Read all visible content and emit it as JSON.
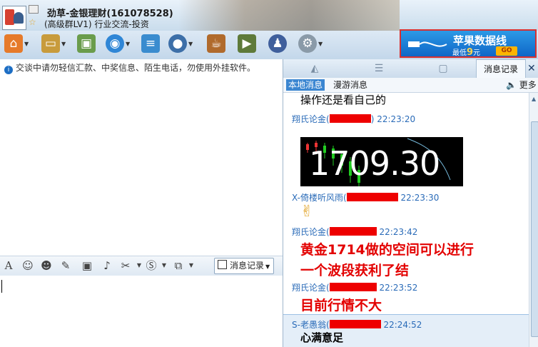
{
  "window": {
    "title": "劲草-金银理财(161078528)",
    "subtitle": "(高级群LV1) 行业交流-投资"
  },
  "ad": {
    "headline": "苹果数据线",
    "price_prefix": "最低",
    "price": "9",
    "price_unit": "元",
    "cta": "GO"
  },
  "notice": {
    "text": "交谈中请勿轻信汇款、中奖信息、陌生电话，勿使用外挂软件。"
  },
  "edit_toolbar": {
    "history_label": "消息记录"
  },
  "right_panel": {
    "tab_history": "消息记录",
    "sub_local": "本地消息",
    "sub_roam": "漫游消息",
    "more": "更多"
  },
  "messages": [
    {
      "text": "操作还是看自己的"
    },
    {
      "sender": "翔氏论金(",
      "suffix": ")",
      "time": "22:23:20",
      "quote_price": "1709.30"
    },
    {
      "sender": "X-倚楼听风雨(",
      "time": "22:23:30",
      "emoji": "victory-hand"
    },
    {
      "sender": "翔氏论金(",
      "time": "22:23:42",
      "lines": [
        "黄金1714做的空间可以进行",
        "一个波段获利了结"
      ]
    },
    {
      "sender": "翔氏论金(",
      "time": "22:23:52",
      "lines": [
        "目前行情不大"
      ]
    },
    {
      "sender": "S-老愚翁(",
      "time": "22:24:52",
      "text": "心满意足"
    }
  ],
  "colors": {
    "highlight_text": "#e30000",
    "sender_blue": "#2a6bb8",
    "redaction": "#ee0000"
  }
}
